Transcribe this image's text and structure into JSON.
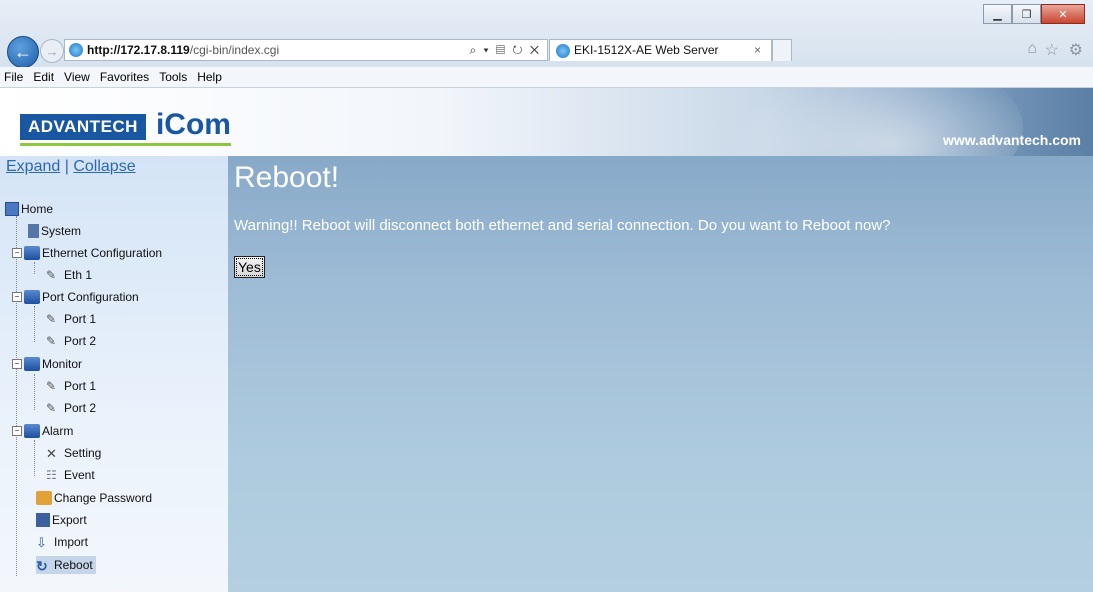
{
  "browser": {
    "url_host": "http://172.17.8.119",
    "url_path": "/cgi-bin/index.cgi",
    "address_controls": "⌕ ▾ ▤ ↻ ✕",
    "tab_title": "EKI-1512X-AE Web Server",
    "tab_close": "×",
    "menu": [
      "File",
      "Edit",
      "View",
      "Favorites",
      "Tools",
      "Help"
    ]
  },
  "banner": {
    "logo_left": "ADVANTECH",
    "logo_right": "iCom",
    "website": "www.advantech.com"
  },
  "sidebar": {
    "expand": "Expand",
    "separator": "|",
    "collapse": "Collapse",
    "items": [
      {
        "label": "Home"
      },
      {
        "label": "System"
      },
      {
        "label": "Ethernet Configuration"
      },
      {
        "label": "Eth 1"
      },
      {
        "label": "Port Configuration"
      },
      {
        "label": "Port 1"
      },
      {
        "label": "Port 2"
      },
      {
        "label": "Monitor"
      },
      {
        "label": "Port 1"
      },
      {
        "label": "Port 2"
      },
      {
        "label": "Alarm"
      },
      {
        "label": "Setting"
      },
      {
        "label": "Event"
      },
      {
        "label": "Change Password"
      },
      {
        "label": "Export"
      },
      {
        "label": "Import"
      },
      {
        "label": "Reboot"
      }
    ]
  },
  "main": {
    "title": "Reboot!",
    "warning": "Warning!! Reboot will disconnect both ethernet and serial connection. Do you want to Reboot now?",
    "yes_button": "Yes"
  }
}
